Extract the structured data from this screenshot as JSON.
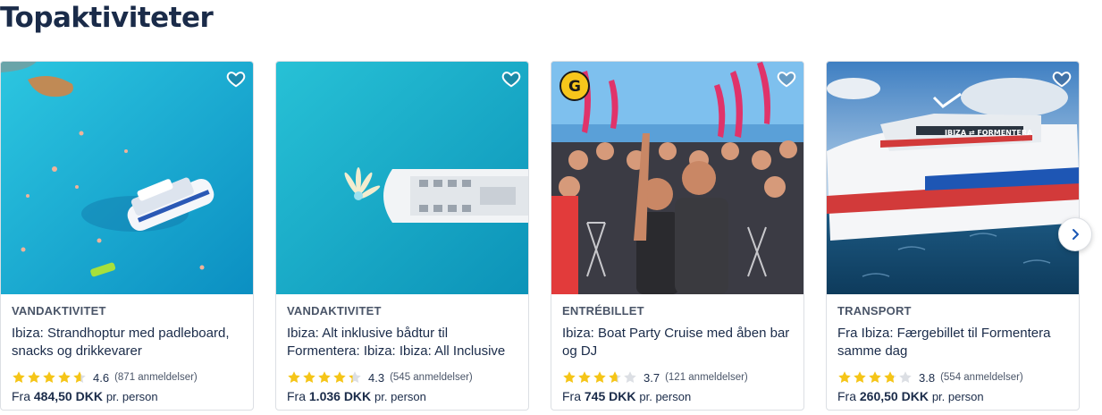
{
  "section": {
    "title": "Topaktiviteter"
  },
  "cards": [
    {
      "category": "VANDAKTIVITET",
      "title": "Ibiza: Strandhoptur med padleboard, snacks og drikkevarer",
      "rating": "4.6",
      "rating_value": 4.6,
      "reviews": "(871 anmeldelser)",
      "price_from": "Fra",
      "price": "484,50 DKK",
      "price_per": "pr. person",
      "image": "boat-in-turquoise-bay"
    },
    {
      "category": "VANDAKTIVITET",
      "title": "Ibiza: Alt inklusive bådtur til Formentera: Ibiza: Ibiza: All Inclusive",
      "rating": "4.3",
      "rating_value": 4.3,
      "reviews": "(545 anmeldelser)",
      "price_from": "Fra",
      "price": "1.036 DKK",
      "price_per": "pr. person",
      "image": "catamaran-aerial"
    },
    {
      "category": "ENTRÉBILLET",
      "title": "Ibiza: Boat Party Cruise med åben bar og DJ",
      "rating": "3.7",
      "rating_value": 3.7,
      "reviews": "(121 anmeldelser)",
      "price_from": "Fra",
      "price": "745 DKK",
      "price_per": "pr. person",
      "image": "boat-party-crowd",
      "badge": "G"
    },
    {
      "category": "TRANSPORT",
      "title": "Fra Ibiza: Færgebillet til Formentera samme dag",
      "rating": "3.8",
      "rating_value": 3.8,
      "reviews": "(554 anmeldelser)",
      "price_from": "Fra",
      "price": "260,50 DKK",
      "price_per": "pr. person",
      "image": "ferry-at-sea",
      "ferry_text": "IBIZA ⇄ FORMENTERA"
    }
  ],
  "colors": {
    "star": "#f5c518",
    "star_empty": "#dcdfe4",
    "text": "#1a2b49",
    "water": "#19b3d2"
  },
  "icons": {
    "wishlist": "heart-icon",
    "next": "chevron-right-icon",
    "star": "star-icon"
  }
}
